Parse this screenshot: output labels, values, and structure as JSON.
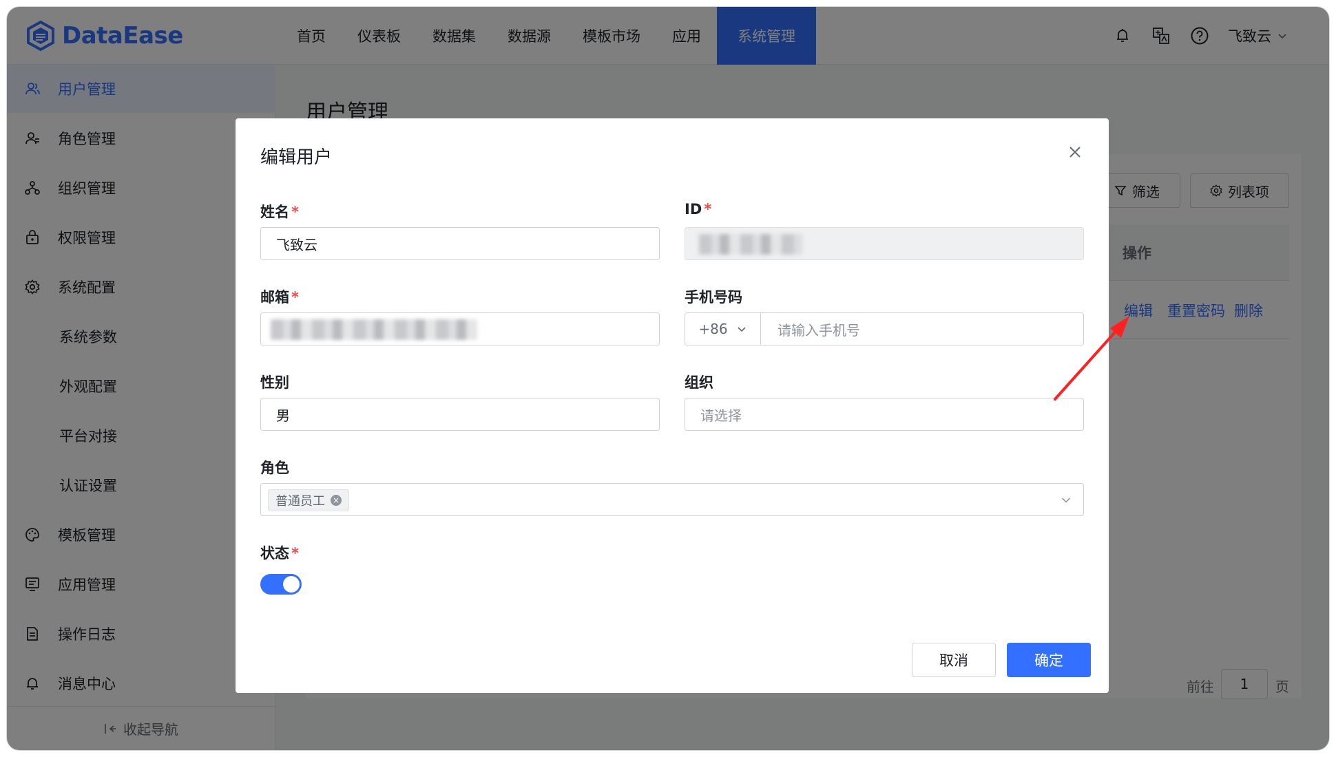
{
  "brand": {
    "name": "DataEase",
    "color": "#3370ff"
  },
  "topnav": {
    "items": [
      "首页",
      "仪表板",
      "数据集",
      "数据源",
      "模板市场",
      "应用",
      "系统管理"
    ],
    "active_index": 6,
    "icons": [
      "notification-icon",
      "translate-icon",
      "help-icon"
    ],
    "user_name": "飞致云"
  },
  "sidebar": {
    "items": [
      {
        "label": "用户管理",
        "icon": "user-icon",
        "active": true
      },
      {
        "label": "角色管理",
        "icon": "role-icon"
      },
      {
        "label": "组织管理",
        "icon": "org-icon"
      },
      {
        "label": "权限管理",
        "icon": "lock-icon"
      },
      {
        "label": "系统配置",
        "icon": "gear-icon"
      },
      {
        "label": "系统参数",
        "sub": true
      },
      {
        "label": "外观配置",
        "sub": true
      },
      {
        "label": "平台对接",
        "sub": true
      },
      {
        "label": "认证设置",
        "sub": true
      },
      {
        "label": "模板管理",
        "icon": "palette-icon"
      },
      {
        "label": "应用管理",
        "icon": "app-icon"
      },
      {
        "label": "操作日志",
        "icon": "log-icon"
      },
      {
        "label": "消息中心",
        "icon": "bell-icon"
      }
    ],
    "collapse_label": "收起导航"
  },
  "main": {
    "page_title": "用户管理",
    "filter_label": "筛选",
    "columns_label": "列表项",
    "ops_header": "操作",
    "row_actions": [
      "编辑",
      "重置密码",
      "删除"
    ],
    "pager": {
      "goto_label": "前往",
      "page_value": "1",
      "page_suffix": "页"
    }
  },
  "dialog": {
    "title": "编辑用户",
    "fields": {
      "name": {
        "label": "姓名",
        "value": "飞致云",
        "required": true
      },
      "id": {
        "label": "ID",
        "required": true
      },
      "email": {
        "label": "邮箱",
        "required": true
      },
      "phone": {
        "label": "手机号码",
        "prefix": "+86",
        "placeholder": "请输入手机号"
      },
      "gender": {
        "label": "性别",
        "value": "男"
      },
      "org": {
        "label": "组织",
        "placeholder": "请选择"
      },
      "role": {
        "label": "角色",
        "tags": [
          "普通员工"
        ]
      },
      "status": {
        "label": "状态",
        "required": true,
        "enabled": true
      }
    },
    "cancel_label": "取消",
    "ok_label": "确定"
  },
  "annotation": {
    "arrow_color": "#ff2020"
  }
}
